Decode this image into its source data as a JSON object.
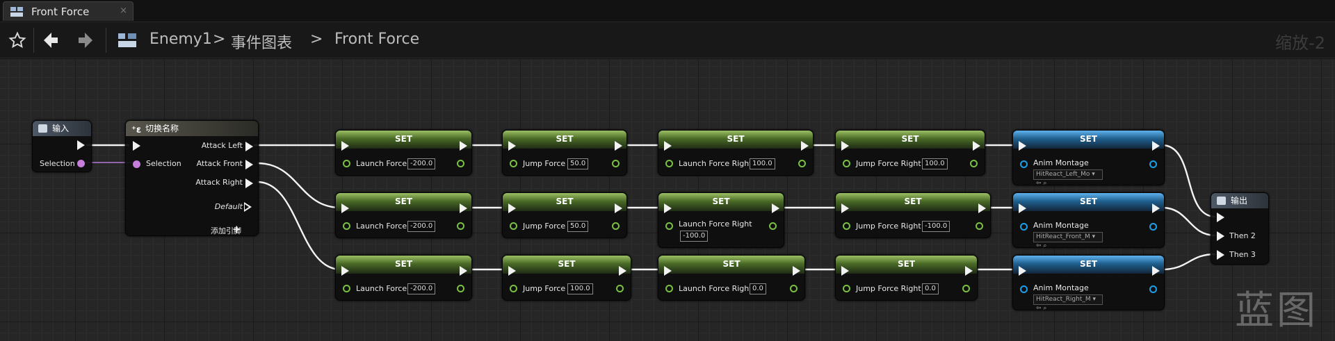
{
  "tab": {
    "title": "Front Force",
    "close": "×"
  },
  "toolbar": {
    "crumb_1": "Enemy1",
    "sep_1": ">",
    "crumb_2": "事件图表",
    "sep_2": ">",
    "crumb_3": "Front Force",
    "zoom": "缩放-2"
  },
  "input_node": {
    "title": "输入",
    "pin": "Selection"
  },
  "switch_node": {
    "title": "切换名称",
    "in_pin": "Selection",
    "out_1": "Attack Left",
    "out_2": "Attack Front",
    "out_3": "Attack Right",
    "default": "Default",
    "add_pin": "添加引脚"
  },
  "output_node": {
    "title": "输出",
    "then_2": "Then 2",
    "then_3": "Then 3"
  },
  "set_title": "SET",
  "row1": {
    "launch": {
      "label": "Launch Force",
      "value": "-200.0"
    },
    "jump": {
      "label": "Jump Force",
      "value": "50.0"
    },
    "launch_r": {
      "label": "Launch Force Right",
      "value": "100.0"
    },
    "jump_r": {
      "label": "Jump Force Right",
      "value": "100.0"
    },
    "anim": {
      "label": "Anim Montage",
      "value": "HitReact_Left_Mo"
    }
  },
  "row2": {
    "launch": {
      "label": "Launch Force",
      "value": "-200.0"
    },
    "jump": {
      "label": "Jump Force",
      "value": "50.0"
    },
    "launch_r": {
      "label": "Launch Force Right",
      "value": "-100.0"
    },
    "jump_r": {
      "label": "Jump Force Right",
      "value": "-100.0"
    },
    "anim": {
      "label": "Anim Montage",
      "value": "HitReact_Front_M"
    }
  },
  "row3": {
    "launch": {
      "label": "Launch Force",
      "value": "-200.0"
    },
    "jump": {
      "label": "Jump Force",
      "value": "100.0"
    },
    "launch_r": {
      "label": "Launch Force Right",
      "value": "0.0"
    },
    "jump_r": {
      "label": "Jump Force Right",
      "value": "0.0"
    },
    "anim": {
      "label": "Anim Montage",
      "value": "HitReact_Right_M"
    }
  },
  "watermark": "蓝图",
  "colors": {
    "exec": "#f2f2f2",
    "float_pin": "#7ac142",
    "object_pin": "#1aa0ea",
    "name_pin": "#c77ddb",
    "set_header": "#496a26",
    "anim_header": "#1f5f8e"
  }
}
